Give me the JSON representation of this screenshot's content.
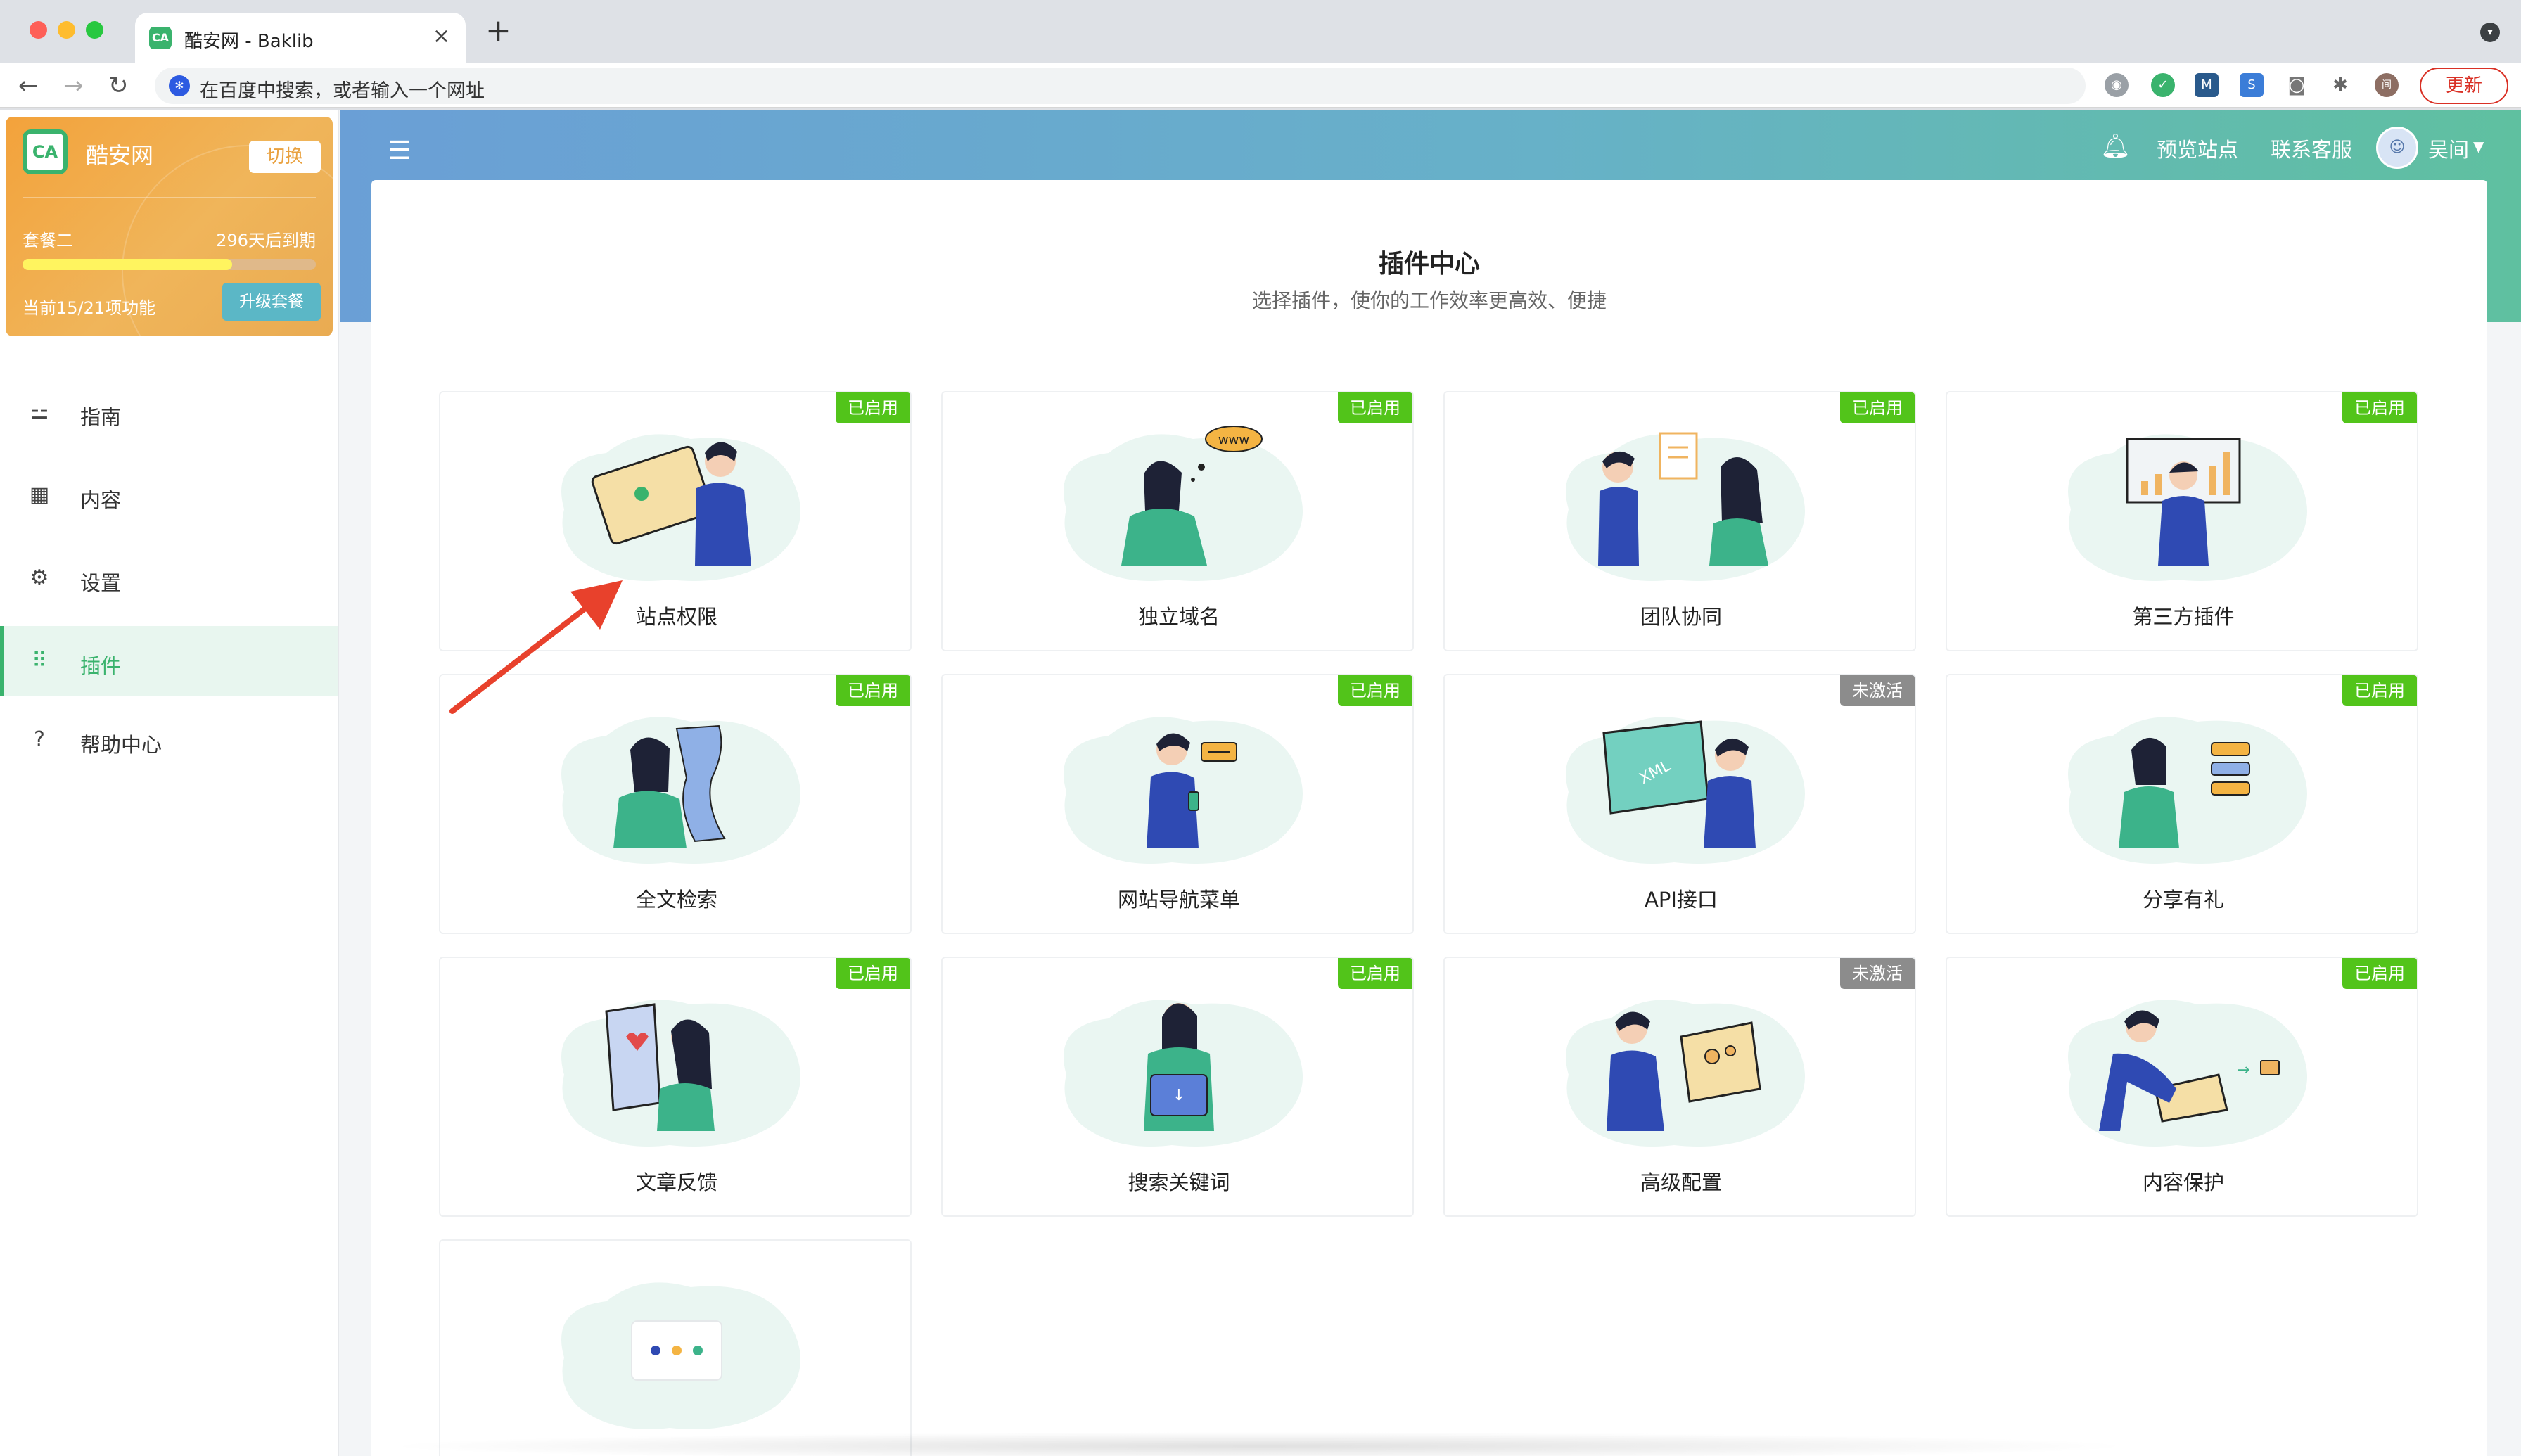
{
  "browser": {
    "tab_title": "酷安网 - Baklib",
    "tab_favicon_text": "CA",
    "address_placeholder": "在百度中搜索，或者输入一个网址",
    "update_label": "更新",
    "extension_m_label": "M"
  },
  "sidebar": {
    "site_name": "酷安网",
    "logo_text": "CA",
    "switch_label": "切换",
    "plan_level": "套餐二",
    "plan_expiry": "296天后到期",
    "features_text": "当前15/21项功能",
    "features_progress": 0.714,
    "upgrade_label": "升级套餐",
    "menu": [
      {
        "label": "指南",
        "icon": "signpost-icon"
      },
      {
        "label": "内容",
        "icon": "grid-icon"
      },
      {
        "label": "设置",
        "icon": "gear-icon"
      },
      {
        "label": "插件",
        "icon": "apps-icon",
        "active": true
      },
      {
        "label": "帮助中心",
        "icon": "help-icon"
      }
    ]
  },
  "header": {
    "preview_label": "预览站点",
    "support_label": "联系客服",
    "user_name": "吴间"
  },
  "panel": {
    "title": "插件中心",
    "subtitle": "选择插件，使你的工作效率更高效、便捷"
  },
  "plugins": [
    {
      "name": "站点权限",
      "status": "已启用",
      "enabled": true,
      "art": "person-laptop"
    },
    {
      "name": "独立域名",
      "status": "已启用",
      "enabled": true,
      "art": "thinking-www"
    },
    {
      "name": "团队协同",
      "status": "已启用",
      "enabled": true,
      "art": "two-people"
    },
    {
      "name": "第三方插件",
      "status": "已启用",
      "enabled": true,
      "art": "chart-board"
    },
    {
      "name": "全文检索",
      "status": "已启用",
      "enabled": true,
      "art": "scroll-reader"
    },
    {
      "name": "网站导航菜单",
      "status": "已启用",
      "enabled": true,
      "art": "phone-chat"
    },
    {
      "name": "API接口",
      "status": "未激活",
      "enabled": false,
      "art": "xml-board"
    },
    {
      "name": "分享有礼",
      "status": "已启用",
      "enabled": true,
      "art": "phone-cards"
    },
    {
      "name": "文章反馈",
      "status": "已启用",
      "enabled": true,
      "art": "heart-doc"
    },
    {
      "name": "搜索关键词",
      "status": "已启用",
      "enabled": true,
      "art": "box-holder"
    },
    {
      "name": "高级配置",
      "status": "未激活",
      "enabled": false,
      "art": "gear-laptop"
    },
    {
      "name": "内容保护",
      "status": "已启用",
      "enabled": true,
      "art": "laptop-folder"
    },
    {
      "name": "",
      "status": "",
      "enabled": null,
      "art": "more-dots"
    }
  ],
  "colors": {
    "brand_green": "#3ab36d",
    "enabled_badge": "#52c41a",
    "inactive_badge": "#8c8c8c",
    "plan_orange": "#f3a23b",
    "annotation_arrow": "#e8412c"
  }
}
